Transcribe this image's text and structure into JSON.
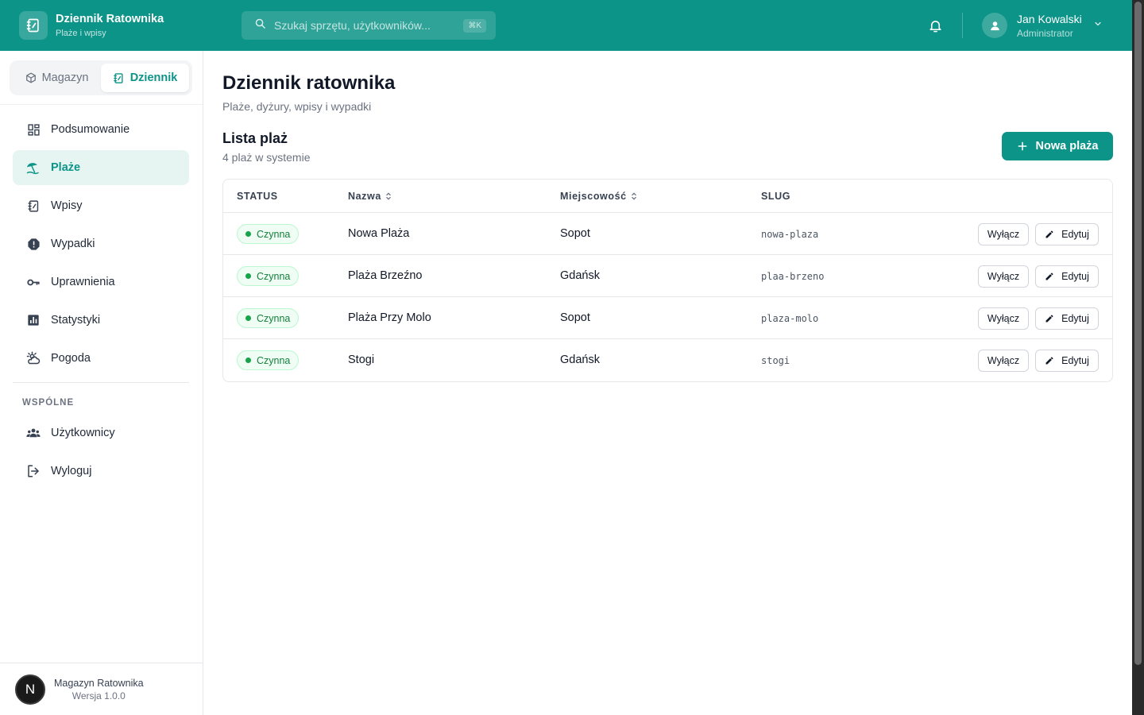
{
  "header": {
    "brand_title": "Dziennik Ratownika",
    "brand_subtitle": "Plaże i wpisy",
    "search_placeholder": "Szukaj sprzętu, użytkowników...",
    "search_shortcut": "⌘K",
    "user_name": "Jan Kowalski",
    "user_role": "Administrator"
  },
  "sidebar": {
    "segments": [
      {
        "label": "Magazyn",
        "icon": "box-icon",
        "active": false
      },
      {
        "label": "Dziennik",
        "icon": "journal-icon",
        "active": true
      }
    ],
    "items": [
      {
        "label": "Podsumowanie",
        "icon": "dashboard-icon"
      },
      {
        "label": "Plaże",
        "icon": "beach-umbrella-icon",
        "active": true
      },
      {
        "label": "Wpisy",
        "icon": "notebook-icon"
      },
      {
        "label": "Wypadki",
        "icon": "alert-icon"
      },
      {
        "label": "Uprawnienia",
        "icon": "key-icon"
      },
      {
        "label": "Statystyki",
        "icon": "chart-icon"
      },
      {
        "label": "Pogoda",
        "icon": "weather-icon"
      }
    ],
    "section_label": "WSPÓLNE",
    "shared_items": [
      {
        "label": "Użytkownicy",
        "icon": "users-icon"
      },
      {
        "label": "Wyloguj",
        "icon": "logout-icon"
      }
    ],
    "footer_logo": "N",
    "footer_title": "Magazyn Ratownika",
    "footer_version": "Wersja 1.0.0"
  },
  "main": {
    "title": "Dziennik ratownika",
    "subtitle": "Plaże, dyżury, wpisy i wypadki",
    "list_title": "Lista plaż",
    "list_subtitle": "4 plaż w systemie",
    "new_button": "Nowa plaża"
  },
  "table": {
    "headers": {
      "status": "STATUS",
      "name": "Nazwa",
      "city": "Miejscowość",
      "slug": "SLUG"
    },
    "disable_label": "Wyłącz",
    "edit_label": "Edytuj",
    "rows": [
      {
        "status": "Czynna",
        "name": "Nowa Plaża",
        "city": "Sopot",
        "slug": "nowa-plaza"
      },
      {
        "status": "Czynna",
        "name": "Plaża Brzeźno",
        "city": "Gdańsk",
        "slug": "plaa-brzeno"
      },
      {
        "status": "Czynna",
        "name": "Plaża Przy Molo",
        "city": "Sopot",
        "slug": "plaza-molo"
      },
      {
        "status": "Czynna",
        "name": "Stogi",
        "city": "Gdańsk",
        "slug": "stogi"
      }
    ]
  },
  "colors": {
    "accent": "#0d9488",
    "status_active": "#16a34a"
  }
}
